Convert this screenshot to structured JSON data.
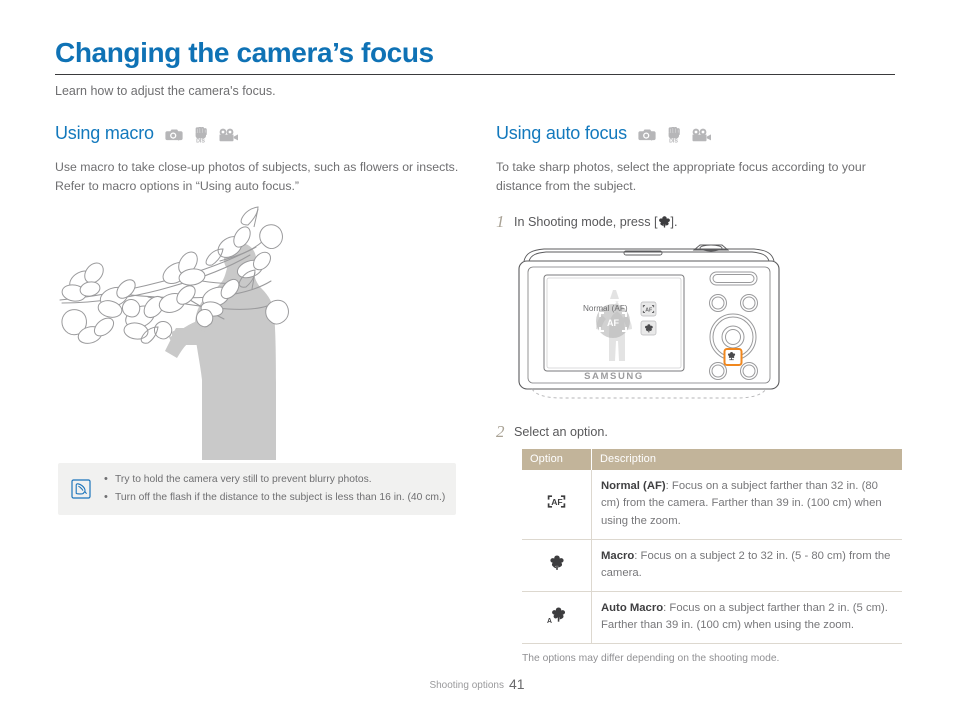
{
  "document": {
    "title": "Changing the camera’s focus",
    "subtitle": "Learn how to adjust the camera's focus.",
    "title_color": "#0f72b5"
  },
  "left_column": {
    "heading": "Using macro",
    "mode_icons": [
      "camera-p-icon",
      "dis-hand-icon",
      "movie-camera-icon"
    ],
    "body": "Use macro to take close-up photos of subjects, such as flowers or insects. Refer to macro options in “Using auto focus.”",
    "illustration": "magnolia-branch-photographer-illustration",
    "note": {
      "icon": "note-pen-icon",
      "items": [
        "Try to hold the camera very still to prevent blurry photos.",
        "Turn off the flash if the distance to the subject is less than 16 in. (40 cm.)"
      ],
      "background": "#f1f1f0"
    }
  },
  "right_column": {
    "heading": "Using auto focus",
    "mode_icons": [
      "camera-p-icon",
      "dis-hand-icon",
      "movie-camera-icon"
    ],
    "body": "To take sharp photos, select the appropriate focus according to your distance from the subject.",
    "steps": [
      {
        "number": "1",
        "text_before": "In Shooting mode, press [",
        "icon": "macro-flower-icon",
        "text_after": "]."
      },
      {
        "number": "2",
        "text_before": "Select an option.",
        "icon": "",
        "text_after": ""
      }
    ],
    "camera": {
      "brand": "SAMSUNG",
      "screen_label": "Normal (AF)",
      "screen_icons": [
        "af-icon",
        "af-small-icon",
        "macro-flower-icon"
      ],
      "highlight_button": "macro-button",
      "highlight_color": "#f0871e"
    },
    "table": {
      "header_background": "#c2b49a",
      "columns": [
        "Option",
        "Description"
      ],
      "rows": [
        {
          "icon": "af-icon",
          "term": "Normal (AF)",
          "description": ": Focus on a subject farther than 32 in. (80 cm) from the camera. Farther than 39 in. (100 cm) when using the zoom."
        },
        {
          "icon": "macro-flower-icon",
          "term": "Macro",
          "description": ": Focus on a subject 2 to 32 in. (5 - 80 cm) from the camera."
        },
        {
          "icon": "auto-macro-flower-icon",
          "term": "Auto Macro",
          "description": ": Focus on a subject farther than 2 in. (5 cm). Farther than 39 in. (100 cm) when using the zoom."
        }
      ],
      "footnote": "The options may differ depending on the shooting mode."
    }
  },
  "footer": {
    "section": "Shooting options",
    "page_number": "41"
  }
}
